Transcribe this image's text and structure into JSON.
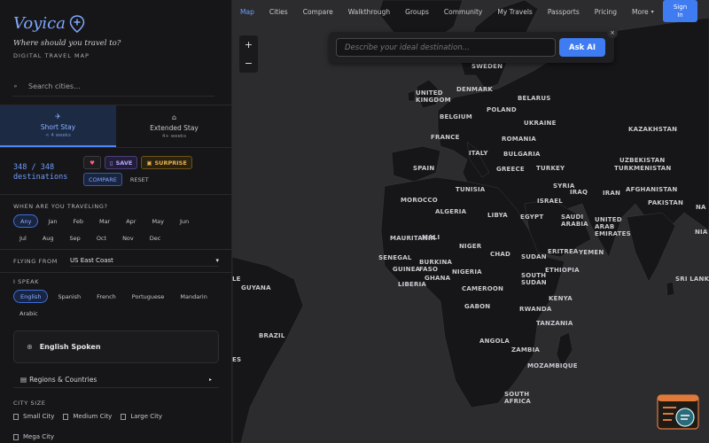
{
  "brand": {
    "name": "Voyica",
    "tagline": "Where should you travel to?",
    "subtitle": "DIGITAL TRAVEL MAP"
  },
  "search": {
    "placeholder": "Search cities..."
  },
  "stay_tabs": [
    {
      "label": "Short Stay",
      "sub": "< 4 weeks",
      "icon": "plane-icon",
      "active": true
    },
    {
      "label": "Extended Stay",
      "sub": "4+ weeks",
      "icon": "house-icon",
      "active": false
    }
  ],
  "destinations": {
    "count": "348 / 348",
    "label": "destinations"
  },
  "actions": {
    "save": "SAVE",
    "surprise": "SURPRISE",
    "compare": "COMPARE",
    "reset": "RESET"
  },
  "when": {
    "title": "WHEN ARE YOU TRAVELING?",
    "options": [
      "Any",
      "Jan",
      "Feb",
      "Mar",
      "Apr",
      "May",
      "Jun",
      "Jul",
      "Aug",
      "Sep",
      "Oct",
      "Nov",
      "Dec"
    ],
    "selected": "Any"
  },
  "flying": {
    "title": "FLYING FROM",
    "value": "US East Coast"
  },
  "speak": {
    "title": "I SPEAK",
    "options": [
      "English",
      "Spanish",
      "French",
      "Portuguese",
      "Mandarin",
      "Arabic"
    ],
    "selected": "English"
  },
  "english_card": {
    "label": "English Spoken"
  },
  "regions": {
    "label": "Regions & Countries"
  },
  "city_size": {
    "title": "CITY SIZE",
    "options": [
      "Small City",
      "Medium City",
      "Large City",
      "Mega City"
    ]
  },
  "nav": {
    "items": [
      "Map",
      "Cities",
      "Compare",
      "Walkthrough",
      "Groups",
      "Community",
      "My Travels",
      "Passports",
      "Pricing",
      "More"
    ],
    "active": "Map",
    "signin": "Sign In"
  },
  "ask": {
    "placeholder": "Describe your ideal destination...",
    "button": "Ask AI"
  },
  "map": {
    "zoom_in": "+",
    "zoom_out": "−",
    "labels": [
      "SWEDEN",
      "UNITED KINGDOM",
      "DENMARK",
      "BELARUS",
      "POLAND",
      "BELGIUM",
      "UKRAINE",
      "KAZAKHSTAN",
      "FRANCE",
      "ROMANIA",
      "ITALY",
      "BULGARIA",
      "SPAIN",
      "GREECE",
      "TURKEY",
      "UZBEKISTAN",
      "TURKMENISTAN",
      "SYRIA",
      "IRAQ",
      "IRAN",
      "AFGHANISTAN",
      "TUNISIA",
      "MOROCCO",
      "ISRAEL",
      "PAKISTAN",
      "ALGERIA",
      "LIBYA",
      "EGYPT",
      "SAUDI ARABIA",
      "UNITED ARAB EMIRATES",
      "MAURITANIA",
      "MALI",
      "NIGER",
      "CHAD",
      "SUDAN",
      "ERITREA",
      "YEMEN",
      "SENEGAL",
      "BURKINA FASO",
      "GUINEA",
      "NIGERIA",
      "ETHIOPIA",
      "LIBERIA",
      "GHANA",
      "SOUTH SUDAN",
      "CAMEROON",
      "KENYA",
      "GUYANA",
      "GABON",
      "RWANDA",
      "TANZANIA",
      "BRAZIL",
      "ANGOLA",
      "ZAMBIA",
      "MOZAMBIQUE",
      "SOUTH AFRICA",
      "LE",
      "SRI LANKA",
      "ES",
      "NA",
      "NIA"
    ]
  }
}
